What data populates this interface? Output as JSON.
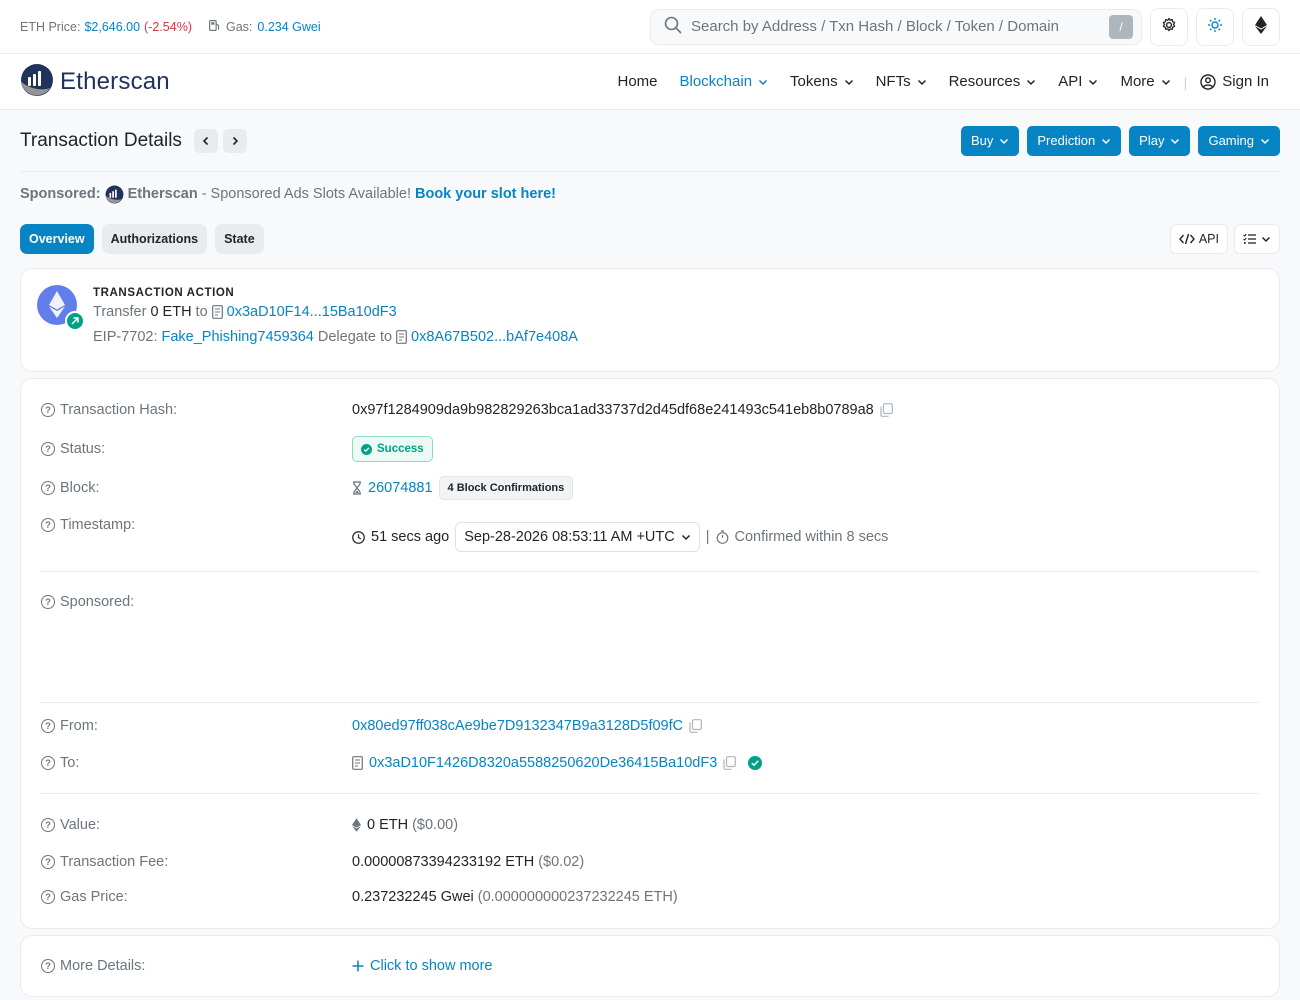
{
  "topbar": {
    "eth_price_label": "ETH Price:",
    "eth_price_value": "$2,646.00",
    "eth_price_change": "(-2.54%)",
    "gas_label": "Gas:",
    "gas_value": "0.234 Gwei",
    "search_placeholder": "Search by Address / Txn Hash / Block / Token / Domain",
    "search_shortcut": "/"
  },
  "nav": {
    "logo_text": "Etherscan",
    "items": [
      {
        "label": "Home"
      },
      {
        "label": "Blockchain"
      },
      {
        "label": "Tokens"
      },
      {
        "label": "NFTs"
      },
      {
        "label": "Resources"
      },
      {
        "label": "API"
      },
      {
        "label": "More"
      }
    ],
    "sign_in": "Sign In"
  },
  "page": {
    "title": "Transaction Details",
    "buttons": [
      "Buy",
      "Prediction",
      "Play",
      "Gaming"
    ]
  },
  "sponsored": {
    "prefix": "Sponsored:",
    "brand": "Etherscan",
    "text": "- Sponsored Ads Slots Available!",
    "cta": "Book your slot here!"
  },
  "tabs": [
    "Overview",
    "Authorizations",
    "State"
  ],
  "tabs_right": {
    "api_label": "API"
  },
  "action": {
    "label": "TRANSACTION ACTION",
    "transfer_word": "Transfer",
    "amount": "0 ETH",
    "to_word": "to",
    "to_address": "0x3aD10F14...15Ba10dF3",
    "eip_label": "EIP-7702:",
    "eip_name": "Fake_Phishing7459364",
    "delegate_word": "Delegate to",
    "delegate_address": "0x8A67B502...bAf7e408A"
  },
  "details": {
    "hash_label": "Transaction Hash:",
    "hash_value": "0x97f1284909da9b982829263bca1ad33737d2d45df68e241493c541eb8b0789a8",
    "status_label": "Status:",
    "status_value": "Success",
    "block_label": "Block:",
    "block_value": "26074881",
    "block_confirmations": "4 Block Confirmations",
    "timestamp_label": "Timestamp:",
    "timestamp_ago": "51 secs ago",
    "timestamp_date": "Sep-28-2026 08:53:11 AM +UTC",
    "timestamp_confirmed": "Confirmed within 8 secs",
    "sponsored_label": "Sponsored:",
    "from_label": "From:",
    "from_value": "0x80ed97ff038cAe9be7D9132347B9a3128D5f09fC",
    "to_label": "To:",
    "to_value": "0x3aD10F1426D8320a5588250620De36415Ba10dF3",
    "value_label": "Value:",
    "value_eth": "0 ETH",
    "value_usd": "($0.00)",
    "fee_label": "Transaction Fee:",
    "fee_eth": "0.00000873394233192 ETH",
    "fee_usd": "($0.02)",
    "gas_label": "Gas Price:",
    "gas_gwei": "0.237232245 Gwei",
    "gas_eth": "(0.000000000237232245 ETH)"
  },
  "more": {
    "label": "More Details:",
    "link": "Click to show more"
  },
  "colors": {
    "accent": "#0784c3",
    "success": "#00a186",
    "negative": "#dc3545"
  }
}
